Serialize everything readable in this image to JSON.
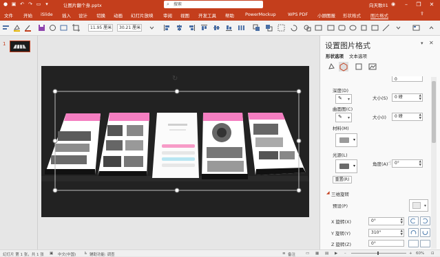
{
  "titlebar": {
    "doc_title": "让图片翻个身.pptx",
    "search_placeholder": "搜索",
    "user": "向天歌01",
    "colors": {
      "accent": "#c43e1c"
    }
  },
  "tabs": [
    "文件",
    "开始",
    "iSlide",
    "插入",
    "设计",
    "切换",
    "动画",
    "幻灯片放映",
    "审阅",
    "视图",
    "开发工具",
    "帮助",
    "PowerMockup",
    "WPS PDF",
    "小顾图报",
    "形状格式",
    "图片格式"
  ],
  "ribbon": {
    "height_value": "11.95 厘米",
    "width_value": "30.21 厘米"
  },
  "slide_pane": {
    "slide_number": "1"
  },
  "format_pane": {
    "title": "设置图片格式",
    "subtabs": [
      "形状选项",
      "文本选项"
    ],
    "depth_label": "深度(D)",
    "depth_size_label": "大小(S)",
    "depth_size_value": "0 磅",
    "contour_label": "曲面图(C)",
    "contour_size_label": "大小(I)",
    "contour_size_value": "0 磅",
    "material_label": "材料(M)",
    "lighting_label": "光源(L)",
    "angle_label": "角度(A)",
    "angle_value": "0°",
    "reset_label": "重置(R)",
    "rotation_section": "三维旋转",
    "preset_label": "预设(P)",
    "x_rotation_label": "X 旋转(X)",
    "x_rotation_value": "0°",
    "y_rotation_label": "Y 旋转(Y)",
    "y_rotation_value": "310°",
    "z_rotation_label": "Z 旋转(Z)",
    "z_rotation_value": "0°",
    "top_value": "0"
  },
  "statusbar": {
    "slide_info": "幻灯片 第 1 张，共 1 张",
    "language": "中文(中国)",
    "accessibility": "辅助功能: 调查",
    "notes": "备注",
    "zoom": "60%"
  }
}
